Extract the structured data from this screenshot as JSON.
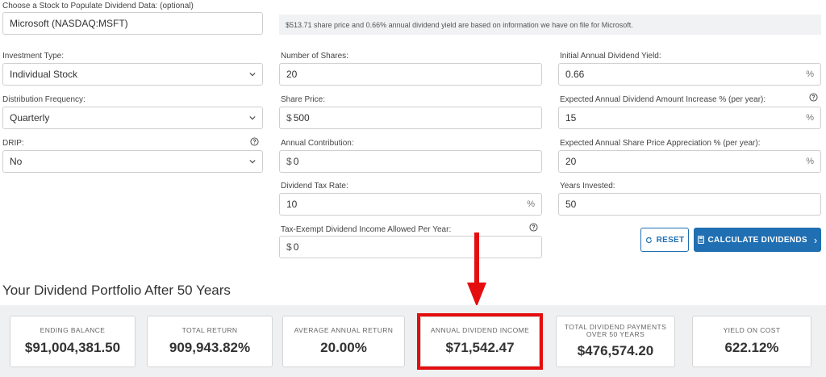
{
  "stock": {
    "label": "Choose a Stock to Populate Dividend Data: (optional)",
    "value": "Microsoft (NASDAQ:MSFT)",
    "note": "$513.71 share price and 0.66% annual dividend yield are based on information we have on file for Microsoft."
  },
  "left": {
    "investment_type_label": "Investment Type:",
    "investment_type_value": "Individual Stock",
    "distribution_label": "Distribution Frequency:",
    "distribution_value": "Quarterly",
    "drip_label": "DRIP:",
    "drip_value": "No"
  },
  "middle": {
    "shares_label": "Number of Shares:",
    "shares_value": "20",
    "price_label": "Share Price:",
    "price_prefix": "$",
    "price_value": "500",
    "contribution_label": "Annual Contribution:",
    "contribution_prefix": "$",
    "contribution_value": "0",
    "tax_label": "Dividend Tax Rate:",
    "tax_value": "10",
    "tax_suffix": "%",
    "exempt_label": "Tax-Exempt Dividend Income Allowed Per Year:",
    "exempt_prefix": "$",
    "exempt_value": "0"
  },
  "right": {
    "yield_label": "Initial Annual Dividend Yield:",
    "yield_value": "0.66",
    "yield_suffix": "%",
    "increase_label": "Expected Annual Dividend Amount Increase % (per year):",
    "increase_value": "15",
    "increase_suffix": "%",
    "appreciation_label": "Expected Annual Share Price Appreciation % (per year):",
    "appreciation_value": "20",
    "appreciation_suffix": "%",
    "years_label": "Years Invested:",
    "years_value": "50"
  },
  "buttons": {
    "reset": "RESET",
    "calculate": "CALCULATE DIVIDENDS",
    "calculate_chevron": "›"
  },
  "results": {
    "title": "Your Dividend Portfolio After 50 Years",
    "cards": [
      {
        "title": "ENDING BALANCE",
        "value": "$91,004,381.50"
      },
      {
        "title": "TOTAL RETURN",
        "value": "909,943.82%"
      },
      {
        "title": "AVERAGE ANNUAL RETURN",
        "value": "20.00%"
      },
      {
        "title": "ANNUAL DIVIDEND INCOME",
        "value": "$71,542.47"
      },
      {
        "title": "TOTAL DIVIDEND PAYMENTS OVER 50 YEARS",
        "value": "$476,574.20"
      },
      {
        "title": "YIELD ON COST",
        "value": "622.12%"
      }
    ]
  },
  "colors": {
    "accent": "#1f6fb2",
    "highlight": "#e40e0e"
  },
  "icons": {
    "help": "question-circle-icon",
    "chevron": "chevron-down-icon",
    "reset": "refresh-icon",
    "calculator": "calculator-icon"
  }
}
